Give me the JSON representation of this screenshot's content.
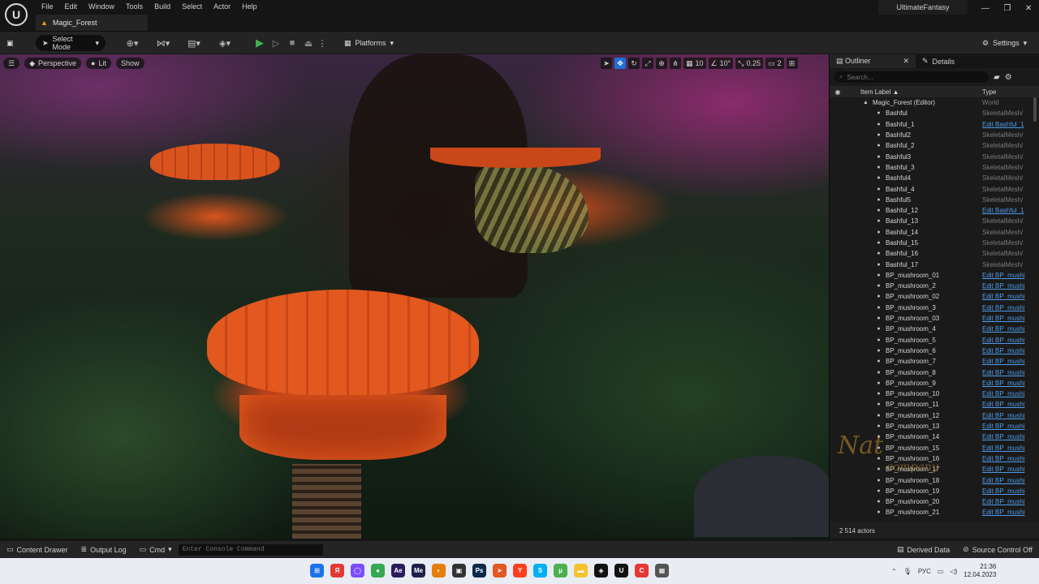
{
  "menu": {
    "items": [
      "File",
      "Edit",
      "Window",
      "Tools",
      "Build",
      "Select",
      "Actor",
      "Help"
    ],
    "project_name": "UltimateFantasy",
    "level_tab": "Magic_Forest"
  },
  "toolbar": {
    "select_mode": "Select Mode",
    "platforms": "Platforms",
    "settings": "Settings"
  },
  "viewport": {
    "perspective": "Perspective",
    "lit": "Lit",
    "show": "Show",
    "grid_snap": "10",
    "rotation_snap": "10°",
    "scale_snap": "0.25",
    "camera_speed": "2"
  },
  "outliner": {
    "tab_outliner": "Outliner",
    "tab_details": "Details",
    "search_placeholder": "Search...",
    "col_label": "Item Label ▲",
    "col_type": "Type",
    "actor_count": "2 514 actors",
    "watermark_line1": "Nat",
    "watermark_line2": "company",
    "rows": [
      {
        "name": "Magic_Forest (Editor)",
        "type": "World",
        "link": false,
        "root": true
      },
      {
        "name": "Bashful",
        "type": "SkeletalMesh/",
        "link": false
      },
      {
        "name": "Bashful_1",
        "type": "Edit Bashful_1",
        "link": true
      },
      {
        "name": "Bashful2",
        "type": "SkeletalMesh/",
        "link": false
      },
      {
        "name": "Bashful_2",
        "type": "SkeletalMesh/",
        "link": false
      },
      {
        "name": "Bashful3",
        "type": "SkeletalMesh/",
        "link": false
      },
      {
        "name": "Bashful_3",
        "type": "SkeletalMesh/",
        "link": false
      },
      {
        "name": "Bashful4",
        "type": "SkeletalMesh/",
        "link": false
      },
      {
        "name": "Bashful_4",
        "type": "SkeletalMesh/",
        "link": false
      },
      {
        "name": "Bashful5",
        "type": "SkeletalMesh/",
        "link": false
      },
      {
        "name": "Bashful_12",
        "type": "Edit Bashful_1",
        "link": true
      },
      {
        "name": "Bashful_13",
        "type": "SkeletalMesh/",
        "link": false
      },
      {
        "name": "Bashful_14",
        "type": "SkeletalMesh/",
        "link": false
      },
      {
        "name": "Bashful_15",
        "type": "SkeletalMesh/",
        "link": false
      },
      {
        "name": "Bashful_16",
        "type": "SkeletalMesh/",
        "link": false
      },
      {
        "name": "Bashful_17",
        "type": "SkeletalMesh/",
        "link": false
      },
      {
        "name": "BP_mushroom_01",
        "type": "Edit BP_mushi",
        "link": true
      },
      {
        "name": "BP_mushroom_2",
        "type": "Edit BP_mushi",
        "link": true
      },
      {
        "name": "BP_mushroom_02",
        "type": "Edit BP_mushi",
        "link": true
      },
      {
        "name": "BP_mushroom_3",
        "type": "Edit BP_mushi",
        "link": true
      },
      {
        "name": "BP_mushroom_03",
        "type": "Edit BP_mushi",
        "link": true
      },
      {
        "name": "BP_mushroom_4",
        "type": "Edit BP_mushi",
        "link": true
      },
      {
        "name": "BP_mushroom_5",
        "type": "Edit BP_mushi",
        "link": true
      },
      {
        "name": "BP_mushroom_6",
        "type": "Edit BP_mushi",
        "link": true
      },
      {
        "name": "BP_mushroom_7",
        "type": "Edit BP_mushi",
        "link": true
      },
      {
        "name": "BP_mushroom_8",
        "type": "Edit BP_mushi",
        "link": true
      },
      {
        "name": "BP_mushroom_9",
        "type": "Edit BP_mushi",
        "link": true
      },
      {
        "name": "BP_mushroom_10",
        "type": "Edit BP_mushi",
        "link": true
      },
      {
        "name": "BP_mushroom_11",
        "type": "Edit BP_mushi",
        "link": true
      },
      {
        "name": "BP_mushroom_12",
        "type": "Edit BP_mushi",
        "link": true
      },
      {
        "name": "BP_mushroom_13",
        "type": "Edit BP_mushi",
        "link": true
      },
      {
        "name": "BP_mushroom_14",
        "type": "Edit BP_mushi",
        "link": true
      },
      {
        "name": "BP_mushroom_15",
        "type": "Edit BP_mushi",
        "link": true
      },
      {
        "name": "BP_mushroom_16",
        "type": "Edit BP_mushi",
        "link": true
      },
      {
        "name": "BP_mushroom_17",
        "type": "Edit BP_mushi",
        "link": true
      },
      {
        "name": "BP_mushroom_18",
        "type": "Edit BP_mushi",
        "link": true
      },
      {
        "name": "BP_mushroom_19",
        "type": "Edit BP_mushi",
        "link": true
      },
      {
        "name": "BP_mushroom_20",
        "type": "Edit BP_mushi",
        "link": true
      },
      {
        "name": "BP_mushroom_21",
        "type": "Edit BP_mushi",
        "link": true
      }
    ]
  },
  "statusbar": {
    "content_drawer": "Content Drawer",
    "output_log": "Output Log",
    "cmd": "Cmd",
    "cmd_placeholder": "Enter Console Command",
    "derived_data": "Derived Data",
    "source_control": "Source Control Off"
  },
  "taskbar": {
    "apps": [
      {
        "icon": "windows-start-icon",
        "color": "#1a73e8",
        "glyph": "⊞"
      },
      {
        "icon": "yandex-browser-icon",
        "color": "#e53935",
        "glyph": "Я"
      },
      {
        "icon": "alice-icon",
        "color": "#7c4dff",
        "glyph": "◯"
      },
      {
        "icon": "chrome-icon",
        "color": "#34a853",
        "glyph": "●"
      },
      {
        "icon": "after-effects-icon",
        "color": "#2a1b5c",
        "glyph": "Ae"
      },
      {
        "icon": "media-encoder-icon",
        "color": "#1d1f4a",
        "glyph": "Me"
      },
      {
        "icon": "blender-icon",
        "color": "#e87d0d",
        "glyph": "◐"
      },
      {
        "icon": "davinci-icon",
        "color": "#333333",
        "glyph": "▣"
      },
      {
        "icon": "photoshop-icon",
        "color": "#0b2a4a",
        "glyph": "Ps"
      },
      {
        "icon": "arrow-app-icon",
        "color": "#e25822",
        "glyph": "➤"
      },
      {
        "icon": "yandex-icon",
        "color": "#fc3f1d",
        "glyph": "Y"
      },
      {
        "icon": "skype-icon",
        "color": "#00aff0",
        "glyph": "S"
      },
      {
        "icon": "utorrent-icon",
        "color": "#4caf50",
        "glyph": "µ"
      },
      {
        "icon": "file-explorer-icon",
        "color": "#f4c430",
        "glyph": "▬"
      },
      {
        "icon": "nvidia-icon",
        "color": "#111111",
        "glyph": "◈"
      },
      {
        "icon": "unreal-engine-icon",
        "color": "#111111",
        "glyph": "U"
      },
      {
        "icon": "coreldraw-icon",
        "color": "#e53935",
        "glyph": "C"
      },
      {
        "icon": "calendar-app-icon",
        "color": "#555555",
        "glyph": "▦"
      }
    ],
    "language": "РУС",
    "time": "21:36",
    "date": "12.04.2023"
  }
}
